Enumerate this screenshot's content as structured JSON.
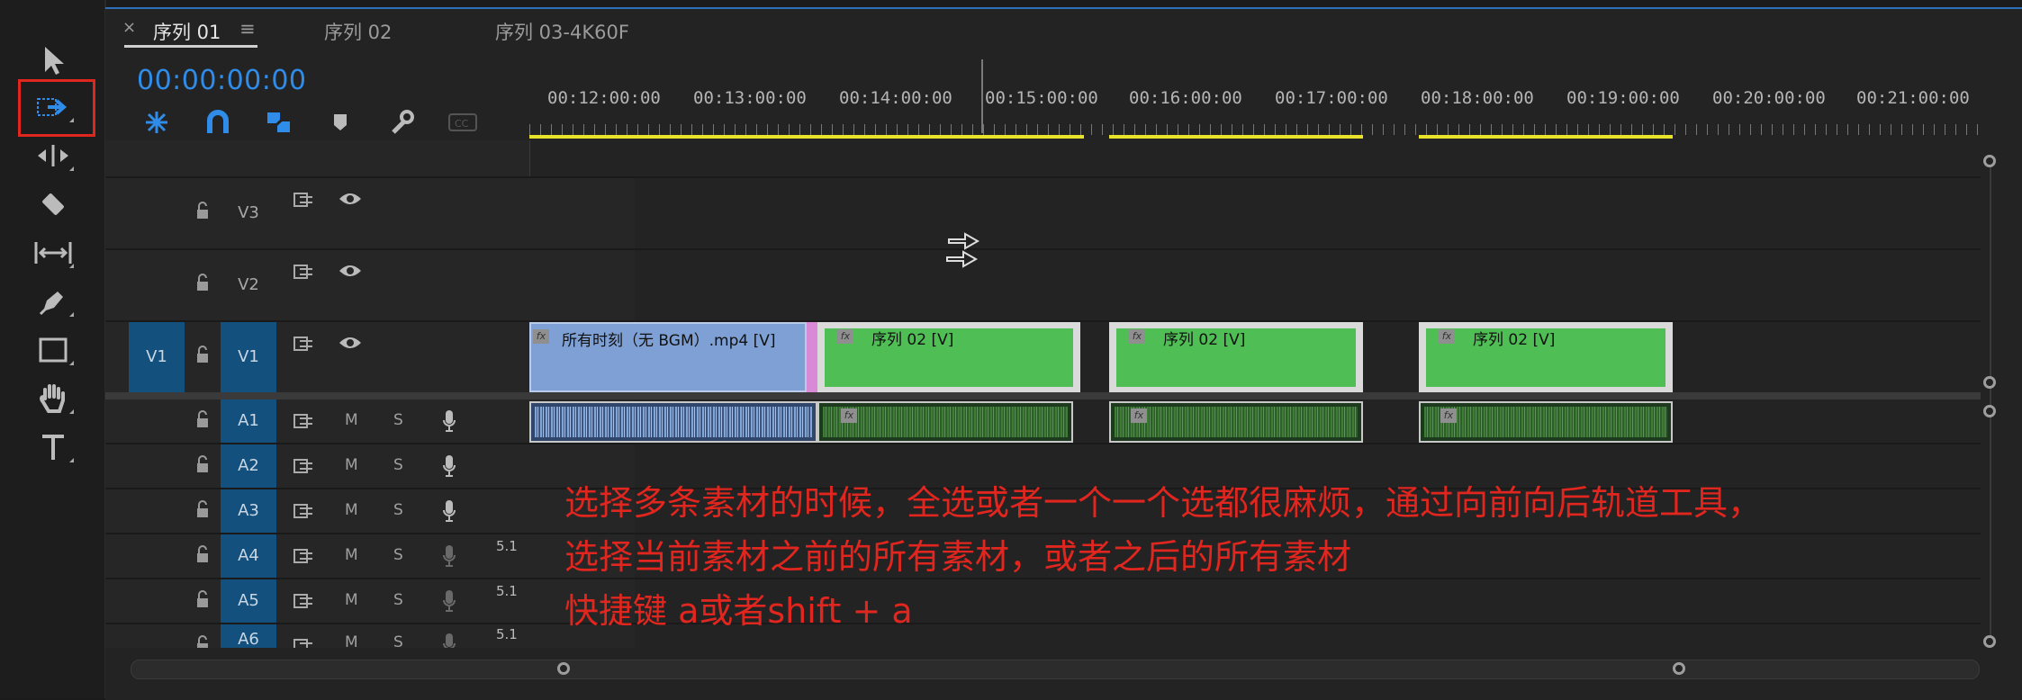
{
  "tabs": [
    {
      "label": "序列 01",
      "active": true
    },
    {
      "label": "序列 02",
      "active": false
    },
    {
      "label": "序列 03-4K60F",
      "active": false
    }
  ],
  "tab_close": "×",
  "tab_menu": "≡",
  "timecode": "00:00:00:00",
  "ruler_labels": [
    "00:12:00:00",
    "00:13:00:00",
    "00:14:00:00",
    "00:15:00:00",
    "00:16:00:00",
    "00:17:00:00",
    "00:18:00:00",
    "00:19:00:00",
    "00:20:00:00",
    "00:21:00:00"
  ],
  "video_tracks": [
    {
      "name": "V3",
      "source": ""
    },
    {
      "name": "V2",
      "source": ""
    },
    {
      "name": "V1",
      "source": "V1"
    }
  ],
  "audio_tracks": [
    {
      "name": "A1",
      "m": "M",
      "s": "S",
      "channels": ""
    },
    {
      "name": "A2",
      "m": "M",
      "s": "S",
      "channels": ""
    },
    {
      "name": "A3",
      "m": "M",
      "s": "S",
      "channels": ""
    },
    {
      "name": "A4",
      "m": "M",
      "s": "S",
      "channels": "5.1"
    },
    {
      "name": "A5",
      "m": "M",
      "s": "S",
      "channels": "5.1"
    },
    {
      "name": "A6",
      "m": "M",
      "s": "S",
      "channels": "5.1"
    }
  ],
  "clips": {
    "clip1": "所有时刻（无 BGM）.mp4 [V]",
    "clip2": "序列 02 [V]",
    "clip3": "序列 02 [V]",
    "clip4": "序列 02 [V]",
    "fx": "fx"
  },
  "annotation": {
    "line1": "选择多条素材的时候，全选或者一个一个选都很麻烦，通过向前向后轨道工具，",
    "line2": "选择当前素材之前的所有素材，或者之后的所有素材",
    "line3": "快捷键 a或者shift + a"
  },
  "colors": {
    "accent": "#2f8ce8",
    "highlight_box": "#e0261e",
    "clip_green": "#4fbe55",
    "clip_blue": "#7ea0d4",
    "workarea": "#e8e22a"
  },
  "icons": [
    "selection-tool-icon",
    "track-select-forward-icon",
    "ripple-edit-icon",
    "razor-icon",
    "slip-icon",
    "pen-icon",
    "rectangle-icon",
    "hand-icon",
    "type-icon"
  ]
}
